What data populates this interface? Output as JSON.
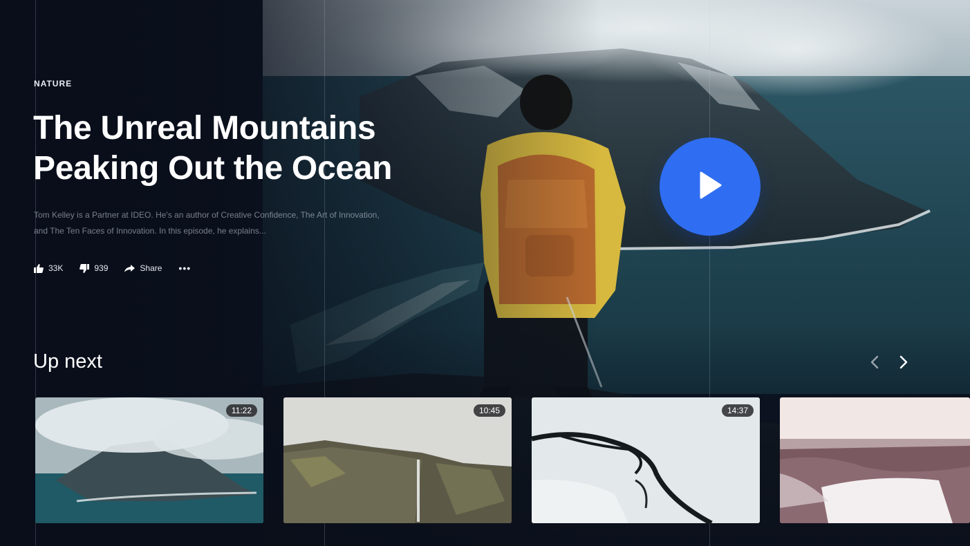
{
  "hero": {
    "category": "NATURE",
    "title_line1": "The Unreal Mountains",
    "title_line2": "Peaking Out the Ocean",
    "description": "Tom Kelley is a Partner at IDEO. He's an author of Creative Confidence, The Art of Innovation, and The Ten Faces of Innovation. In this episode, he explains...",
    "likes": "33K",
    "dislikes": "939",
    "share_label": "Share",
    "more_label": "•••"
  },
  "up_next": {
    "heading": "Up next",
    "videos": [
      {
        "duration": "11:22",
        "scene": "cloudy-cape-aerial"
      },
      {
        "duration": "10:45",
        "scene": "mossy-cliff-waterfall"
      },
      {
        "duration": "14:37",
        "scene": "snowy-river-aerial"
      },
      {
        "duration": "",
        "scene": "snowy-lake-dusk"
      }
    ]
  },
  "icons": {
    "like": "thumb-up-icon",
    "dislike": "thumb-down-icon",
    "share": "share-arrow-icon",
    "play": "play-icon",
    "prev": "chevron-left-icon",
    "next": "chevron-right-icon"
  },
  "colors": {
    "accent": "#2f6ef2",
    "background": "#0b111d",
    "text": "#ffffff"
  }
}
